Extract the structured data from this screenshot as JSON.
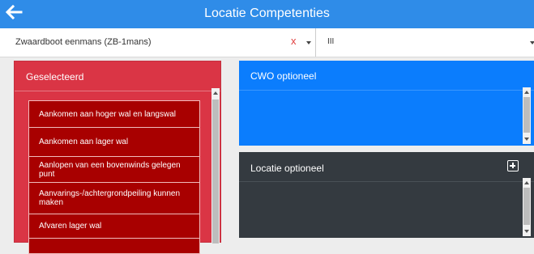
{
  "header": {
    "title": "Locatie Competenties",
    "back_icon": "arrow-left-icon"
  },
  "filters": {
    "boat_select": {
      "value": "Zwaardboot eenmans (ZB-1mans)",
      "clear_label": "x"
    },
    "level_select": {
      "value": "III"
    }
  },
  "panels": {
    "selected": {
      "title": "Geselecteerd",
      "items": [
        "Aankomen aan hoger wal en langswal",
        "Aankomen aan lager wal",
        "Aanlopen van een bovenwinds gelegen punt",
        "Aanvarings-/achtergrondpeiling kunnen maken",
        "Afvaren lager wal",
        ""
      ]
    },
    "cwo_optional": {
      "title": "CWO optioneel"
    },
    "location_optional": {
      "title": "Locatie optioneel",
      "add_icon": "plus-square-icon"
    }
  },
  "colors": {
    "header_bg": "#2f8ce8",
    "selected_panel": "#da3545",
    "selected_item": "#a80000",
    "cwo_panel": "#0b7dfd",
    "location_panel": "#343a40"
  }
}
